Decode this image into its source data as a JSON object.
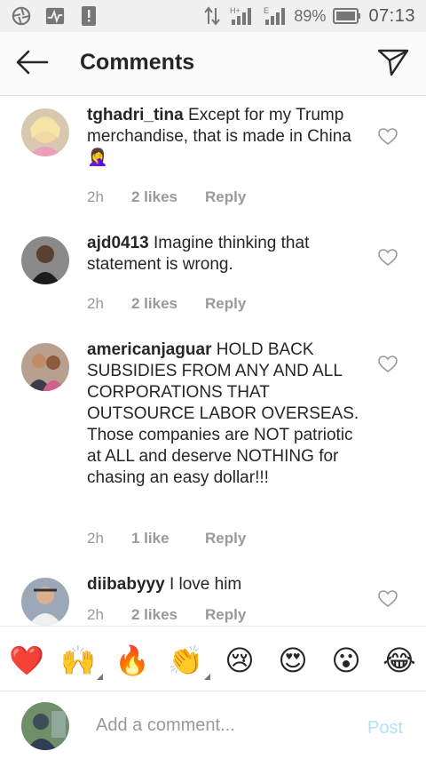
{
  "status_bar": {
    "battery_percent": "89%",
    "time": "07:13",
    "network_type": "H+",
    "network_type2": "E"
  },
  "header": {
    "title": "Comments",
    "back_icon": "arrow-left-icon",
    "send_icon": "paper-plane-icon"
  },
  "comments": [
    {
      "username": "tghadri_tina",
      "text": "Except for my Trump merchandise, that is made in China 🤦‍♀️",
      "time": "2h",
      "likes": "2 likes",
      "reply": "Reply"
    },
    {
      "username": "ajd0413",
      "text": "Imagine thinking that statement is wrong.",
      "time": "2h",
      "likes": "2 likes",
      "reply": "Reply"
    },
    {
      "username": "americanjaguar",
      "text": "HOLD BACK SUBSIDIES FROM ANY AND ALL CORPORATIONS THAT OUTSOURCE LABOR OVERSEAS. Those companies are NOT patriotic at ALL and deserve NOTHING for chasing an easy dollar!!!",
      "time": "2h",
      "likes": "1 like",
      "reply": "Reply"
    },
    {
      "username": "diibabyyy",
      "text": "I love him",
      "time": "2h",
      "likes": "2 likes",
      "reply": "Reply"
    }
  ],
  "emoji_bar": [
    "❤️",
    "🙌",
    "🔥",
    "👏",
    "😢",
    "😍",
    "😮",
    "😂"
  ],
  "input": {
    "placeholder": "Add a comment...",
    "post_label": "Post"
  },
  "colors": {
    "accent_post_disabled": "#b2dffc",
    "meta_gray": "#999999",
    "text": "#262626"
  }
}
